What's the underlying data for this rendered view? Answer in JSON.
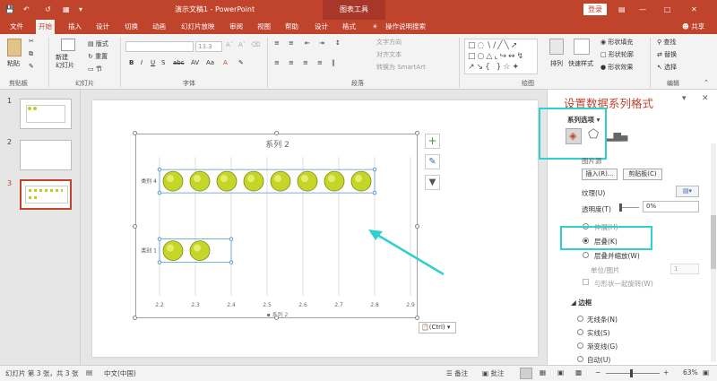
{
  "titlebar": {
    "title": "演示文稿1 - PowerPoint",
    "context_tab": "图表工具",
    "login": "登录"
  },
  "tabs": [
    "文件",
    "开始",
    "插入",
    "设计",
    "切换",
    "动画",
    "幻灯片放映",
    "审阅",
    "视图",
    "帮助",
    "设计",
    "格式"
  ],
  "tell_me": "操作说明搜索",
  "share": "共享",
  "ribbon": {
    "paste": "粘贴",
    "clipboard_group": "剪贴板",
    "new_slide": "新建\n幻灯片",
    "layout": "版式",
    "reset": "重置",
    "section": "节",
    "slides_group": "幻灯片",
    "font_size": "13.3",
    "font_group": "字体",
    "text_direction": "文字方向",
    "align_text": "对齐文本",
    "convert_smartart": "转换为 SmartArt",
    "paragraph_group": "段落",
    "arrange": "排列",
    "quick_styles": "快速样式",
    "shape_fill": "形状填充",
    "shape_outline": "形状轮廓",
    "shape_effects": "形状效果",
    "drawing_group": "绘图",
    "find": "查找",
    "replace": "替换",
    "select": "选择",
    "editing_group": "编辑"
  },
  "slides": [
    {
      "num": "1"
    },
    {
      "num": "2"
    },
    {
      "num": "3"
    }
  ],
  "chart": {
    "title": "系列 2",
    "legend": "系列 2",
    "ctrl_label": "(Ctrl)"
  },
  "chart_data": {
    "type": "bar",
    "title": "系列 2",
    "categories": [
      "类别 4",
      "类别 1"
    ],
    "series": [
      {
        "name": "系列 2",
        "values": [
          2.8,
          2.4
        ]
      }
    ],
    "xlim": [
      2.2,
      2.9
    ],
    "x_ticks": [
      "2.2",
      "2.3",
      "2.4",
      "2.5",
      "2.6",
      "2.7",
      "2.8",
      "2.9"
    ],
    "fill": "picture-stacked-tennis-balls",
    "legend_position": "bottom"
  },
  "pane": {
    "title": "设置数据系列格式",
    "options_label": "系列选项",
    "section_fill": "图片源",
    "insert_btn": "插入(R)...",
    "clipboard_btn": "剪贴板(C)",
    "texture": "纹理(U)",
    "transparency": "透明度(T)",
    "transparency_value": "0%",
    "stretch": "伸展(H)",
    "stack": "层叠(K)",
    "stack_scale": "层叠并缩放(W)",
    "units_per_picture": "单位/图片",
    "units_value": "1",
    "rotate_with_shape": "与形状一起旋转(W)",
    "border_section": "边框",
    "no_line": "无线条(N)",
    "solid_line": "实线(S)",
    "gradient_line": "渐变线(G)",
    "auto": "自动(U)"
  },
  "status": {
    "slide_info": "幻灯片 第 3 张，共 3 张",
    "language": "中文(中国)",
    "notes": "备注",
    "comments": "批注",
    "zoom": "63%"
  },
  "colors": {
    "accent": "#c0432c",
    "highlight": "#2fd0d0"
  }
}
